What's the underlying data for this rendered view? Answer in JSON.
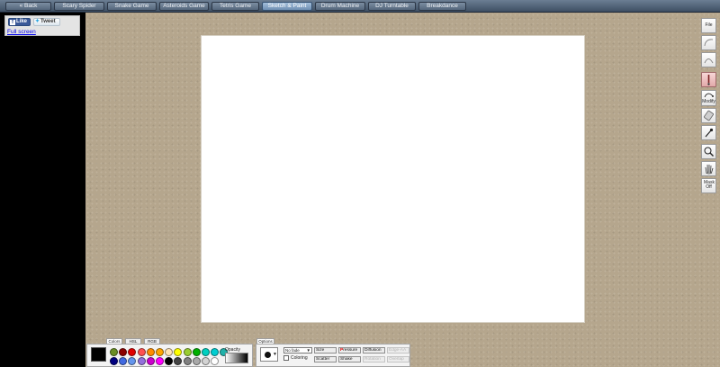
{
  "nav": {
    "items": [
      {
        "label": "« Back",
        "active": false
      },
      {
        "label": "Scary Spider",
        "active": false
      },
      {
        "label": "Snake Game",
        "active": false
      },
      {
        "label": "Asteroids Game",
        "active": false
      },
      {
        "label": "Tetris Game",
        "active": false
      },
      {
        "label": "Sketch & Paint",
        "active": true
      },
      {
        "label": "Drum Machine",
        "active": false
      },
      {
        "label": "DJ Turntable",
        "active": false
      },
      {
        "label": "Breakdance",
        "active": false
      }
    ]
  },
  "social": {
    "like_label": "Like",
    "tweet_label": "Tweet",
    "fullscreen_label": "Full screen"
  },
  "tools": [
    {
      "name": "file",
      "label": "File",
      "icon": "file-icon"
    },
    {
      "name": "curve-1",
      "label": "",
      "icon": "curve-icon"
    },
    {
      "name": "curve-2",
      "label": "",
      "icon": "curve-icon"
    },
    {
      "name": "brush",
      "label": "",
      "icon": "brush-icon",
      "selected": true
    },
    {
      "name": "modify",
      "label": "Modify",
      "icon": "modify-icon"
    },
    {
      "name": "eraser",
      "label": "",
      "icon": "eraser-icon"
    },
    {
      "name": "eyedropper",
      "label": "",
      "icon": "eyedropper-icon"
    },
    {
      "name": "zoom",
      "label": "",
      "icon": "magnifier-icon"
    },
    {
      "name": "hand",
      "label": "",
      "icon": "hand-icon"
    },
    {
      "name": "mask",
      "label": "Mask Off",
      "icon": "mask-icon"
    }
  ],
  "palette": {
    "tabs": [
      "Colors",
      "HSL",
      "RGB"
    ],
    "active_tab": "Colors",
    "current_color": "#000000",
    "opacity_label": "Opacity",
    "swatches_row1": [
      "#6b8e23",
      "#8b0000",
      "#e00000",
      "#ff5050",
      "#ff8c00",
      "#ffa500",
      "#ffe4b5",
      "#ffff00",
      "#9acd32",
      "#00b000",
      "#00d0c0",
      "#00ced1",
      "#20b2aa"
    ],
    "swatches_row2": [
      "#000080",
      "#4169e1",
      "#6495ed",
      "#9370db",
      "#cc00cc",
      "#ff00ff",
      "#000000",
      "#444444",
      "#808080",
      "#a9a9a9",
      "#d3d3d3",
      "#ffffff"
    ]
  },
  "options": {
    "tab_label": "Options",
    "fade_value": "No fade",
    "coloring_label": "Coloring",
    "buttons": [
      {
        "label": "Size",
        "state": "on"
      },
      {
        "label": "Pressure",
        "state": "on-highlight"
      },
      {
        "label": "Diffusion",
        "state": "on"
      },
      {
        "label": "Edge-AA",
        "state": "disabled"
      },
      {
        "label": "Scatter",
        "state": "on"
      },
      {
        "label": "Shake",
        "state": "on"
      },
      {
        "label": "Rotation",
        "state": "disabled"
      },
      {
        "label": "Overlap",
        "state": "disabled"
      }
    ]
  }
}
